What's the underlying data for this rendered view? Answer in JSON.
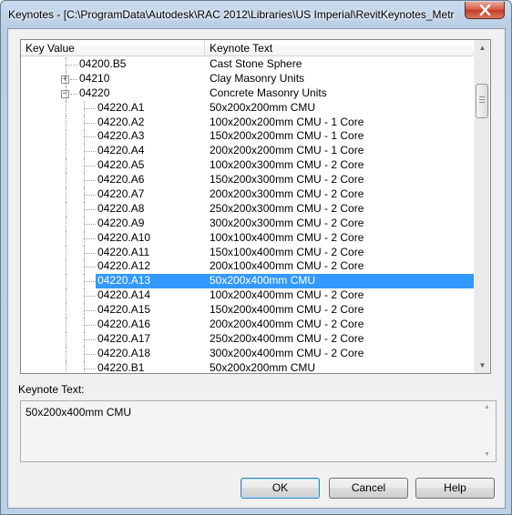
{
  "window": {
    "title": "Keynotes - [C:\\ProgramData\\Autodesk\\RAC 2012\\Libraries\\US Imperial\\RevitKeynotes_Metri..."
  },
  "tree": {
    "columns": [
      "Key Value",
      "Keynote Text"
    ],
    "rows": [
      {
        "key": "04200.B5",
        "text": "Cast Stone Sphere"
      },
      {
        "key": "04210",
        "text": "Clay Masonry Units"
      },
      {
        "key": "04220",
        "text": "Concrete Masonry Units"
      },
      {
        "key": "04220.A1",
        "text": "50x200x200mm CMU"
      },
      {
        "key": "04220.A2",
        "text": "100x200x200mm CMU - 1 Core"
      },
      {
        "key": "04220.A3",
        "text": "150x200x200mm CMU - 1 Core"
      },
      {
        "key": "04220.A4",
        "text": "200x200x200mm CMU - 1 Core"
      },
      {
        "key": "04220.A5",
        "text": "100x200x300mm CMU - 2 Core"
      },
      {
        "key": "04220.A6",
        "text": "150x200x300mm CMU - 2 Core"
      },
      {
        "key": "04220.A7",
        "text": "200x200x300mm CMU - 2 Core"
      },
      {
        "key": "04220.A8",
        "text": "250x200x300mm CMU - 2 Core"
      },
      {
        "key": "04220.A9",
        "text": "300x200x300mm CMU - 2 Core"
      },
      {
        "key": "04220.A10",
        "text": "100x100x400mm CMU - 2 Core"
      },
      {
        "key": "04220.A11",
        "text": "150x100x400mm CMU - 2 Core"
      },
      {
        "key": "04220.A12",
        "text": "200x100x400mm CMU - 2 Core"
      },
      {
        "key": "04220.A13",
        "text": "50x200x400mm CMU",
        "selected": true
      },
      {
        "key": "04220.A14",
        "text": "100x200x400mm CMU - 2 Core"
      },
      {
        "key": "04220.A15",
        "text": "150x200x400mm CMU - 2 Core"
      },
      {
        "key": "04220.A16",
        "text": "200x200x400mm CMU - 2 Core"
      },
      {
        "key": "04220.A17",
        "text": "250x200x400mm CMU - 2 Core"
      },
      {
        "key": "04220.A18",
        "text": "300x200x400mm CMU - 2 Core"
      },
      {
        "key": "04220.B1",
        "text": "50x200x200mm CMU"
      }
    ]
  },
  "keynote_text": {
    "label": "Keynote Text:",
    "value": "50x200x400mm CMU"
  },
  "buttons": {
    "ok": "OK",
    "cancel": "Cancel",
    "help": "Help"
  },
  "colors": {
    "selection": "#3399ff",
    "close_button": "#c7432d"
  }
}
